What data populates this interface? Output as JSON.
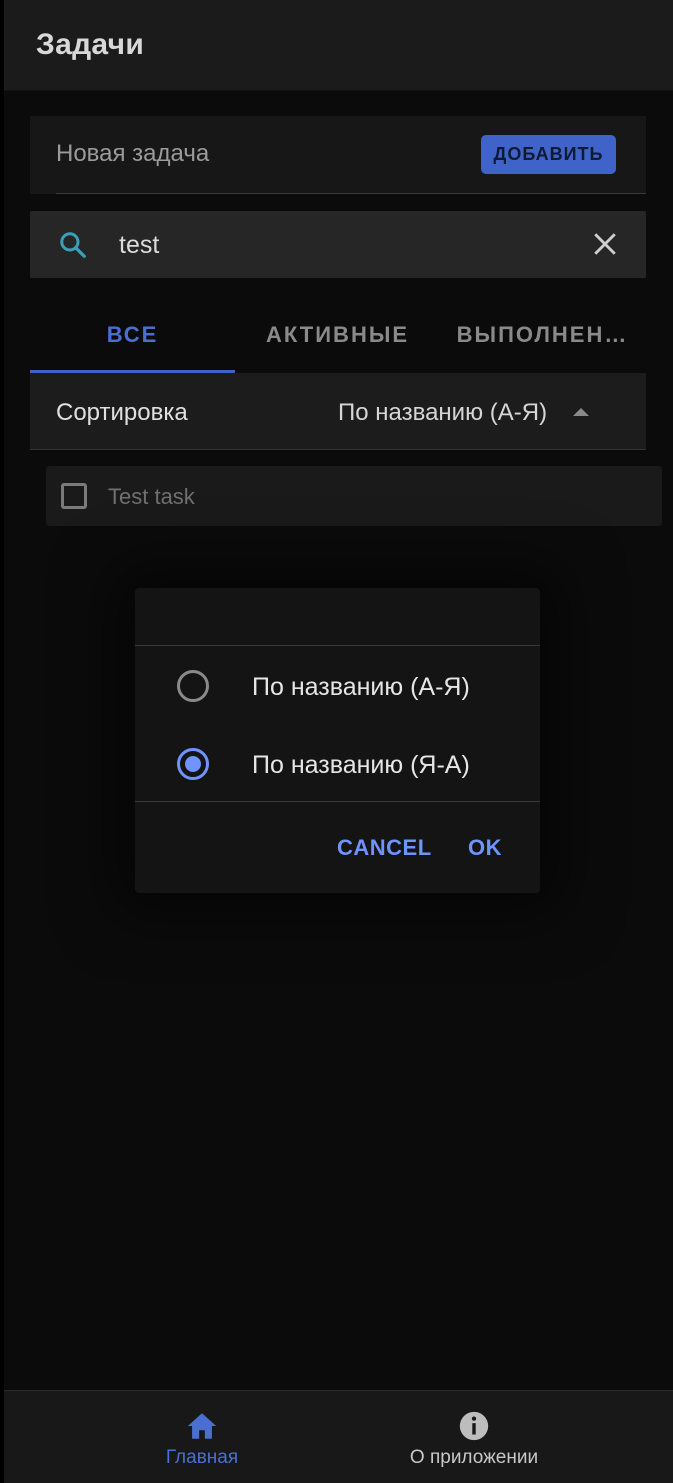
{
  "appbar": {
    "title": "Задачи"
  },
  "new_task": {
    "placeholder": "Новая задача",
    "add_label": "ДОБАВИТЬ"
  },
  "search": {
    "value": "test",
    "icon": "search-icon",
    "clear_icon": "close-icon"
  },
  "tabs": [
    {
      "label": "ВСЕ",
      "active": true
    },
    {
      "label": "АКТИВНЫЕ",
      "active": false
    },
    {
      "label": "ВЫПОЛНЕН…",
      "active": false
    }
  ],
  "sort": {
    "label": "Сортировка",
    "value": "По названию (А-Я)"
  },
  "tasks": [
    {
      "label": "Test task",
      "checked": false
    }
  ],
  "dialog": {
    "options": [
      {
        "label": "По названию (А-Я)",
        "selected": false
      },
      {
        "label": "По названию (Я-А)",
        "selected": true
      }
    ],
    "cancel_label": "CANCEL",
    "ok_label": "OK"
  },
  "bottom_nav": [
    {
      "label": "Главная",
      "icon": "home-icon",
      "active": true
    },
    {
      "label": "О приложении",
      "icon": "info-icon",
      "active": false
    }
  ],
  "colors": {
    "accent": "#3f63c8",
    "accent_light": "#6f93ff",
    "search_icon": "#38a0b8"
  }
}
